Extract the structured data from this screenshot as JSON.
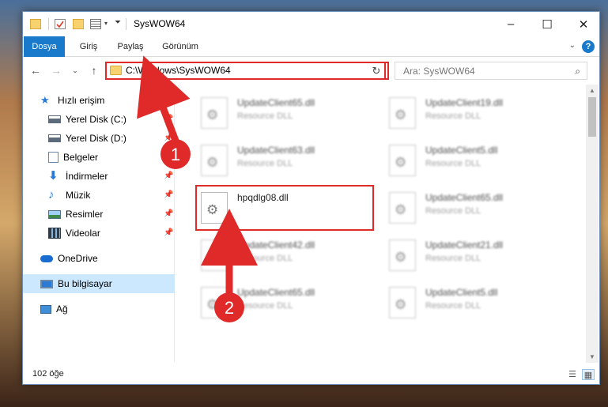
{
  "window": {
    "title": "SysWOW64",
    "controls": {
      "minimize": "–",
      "maximize": "☐",
      "close": "✕"
    }
  },
  "ribbon": {
    "tabs": [
      {
        "label": "Dosya",
        "active": true
      },
      {
        "label": "Giriş"
      },
      {
        "label": "Paylaş"
      },
      {
        "label": "Görünüm"
      }
    ],
    "help": "?"
  },
  "navigation": {
    "address": "C:\\Windows\\SysWOW64",
    "search_placeholder": "Ara: SysWOW64",
    "icons": {
      "back": "arrow-left-icon",
      "forward": "arrow-right-icon",
      "recent": "chevron-down-icon",
      "up": "arrow-up-icon",
      "refresh": "refresh-icon",
      "search": "search-icon"
    }
  },
  "sidebar": {
    "items": [
      {
        "label": "Hızlı erişim",
        "icon": "star-icon",
        "pinned": false
      },
      {
        "label": "Yerel Disk (C:)",
        "icon": "drive-icon",
        "pinned": true
      },
      {
        "label": "Yerel Disk (D:)",
        "icon": "drive-icon",
        "pinned": true
      },
      {
        "label": "Belgeler",
        "icon": "documents-icon",
        "pinned": true
      },
      {
        "label": "İndirmeler",
        "icon": "download-icon",
        "pinned": true
      },
      {
        "label": "Müzik",
        "icon": "music-icon",
        "pinned": true
      },
      {
        "label": "Resimler",
        "icon": "pictures-icon",
        "pinned": true
      },
      {
        "label": "Videolar",
        "icon": "videos-icon",
        "pinned": true
      },
      {
        "label": "OneDrive",
        "icon": "cloud-icon",
        "pinned": false
      },
      {
        "label": "Bu bilgisayar",
        "icon": "computer-icon",
        "pinned": false,
        "selected": true
      },
      {
        "label": "Ağ",
        "icon": "network-icon",
        "pinned": false
      }
    ]
  },
  "files": [
    {
      "name": "UpdateClient65.dll",
      "desc": "Resource DLL"
    },
    {
      "name": "UpdateClient19.dll",
      "desc": "Resource DLL"
    },
    {
      "name": "UpdateClient63.dll",
      "desc": "Resource DLL"
    },
    {
      "name": "UpdateClient5.dll",
      "desc": "Resource DLL"
    },
    {
      "name": "hpqdlg08.dll",
      "desc": "",
      "highlighted": true
    },
    {
      "name": "UpdateClient65.dll",
      "desc": "Resource DLL"
    },
    {
      "name": "UpdateClient42.dll",
      "desc": "Resource DLL"
    },
    {
      "name": "UpdateClient21.dll",
      "desc": "Resource DLL"
    },
    {
      "name": "UpdateClient65.dll",
      "desc": "Resource DLL"
    },
    {
      "name": "UpdateClient5.dll",
      "desc": "Resource DLL"
    }
  ],
  "status": {
    "item_count": "102 öğe"
  },
  "annotations": {
    "step1": "1",
    "step2": "2",
    "color": "#e02a2a"
  }
}
